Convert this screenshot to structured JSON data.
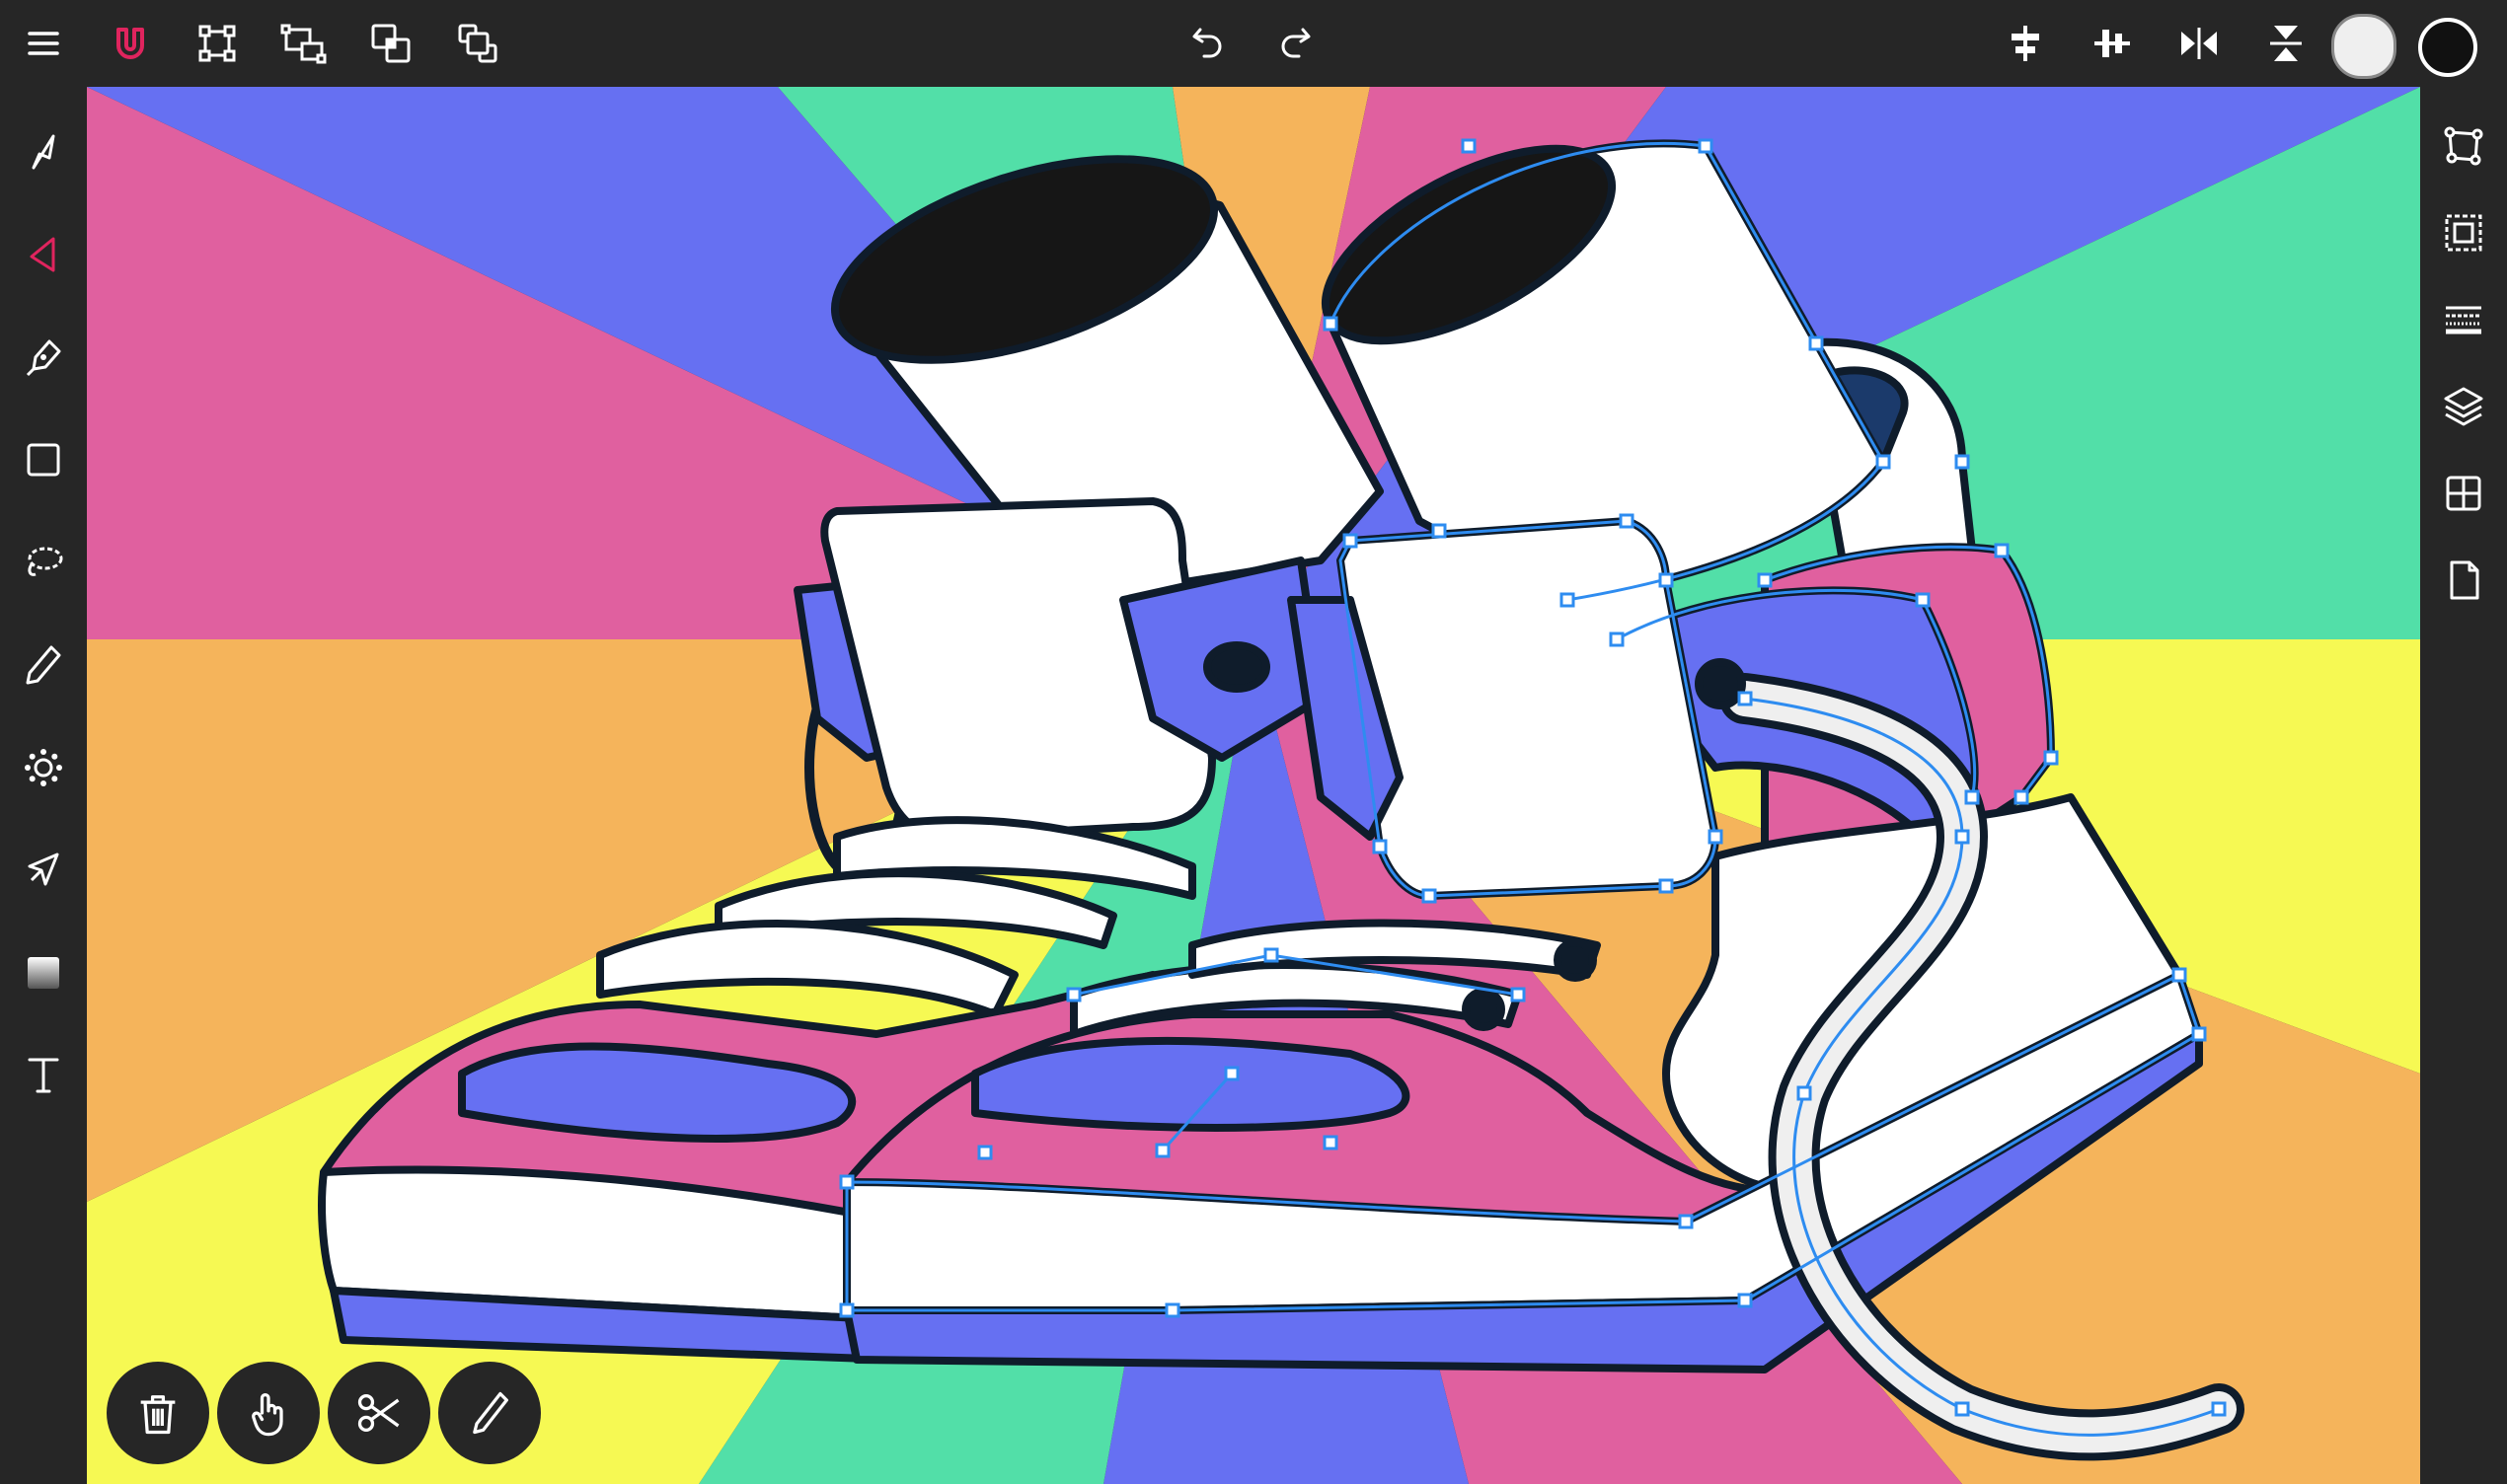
{
  "colors": {
    "chrome": "#262626",
    "icon": "#ffffff",
    "accent": "#e0245e",
    "fill_color": "#efefef",
    "stroke_color": "#111111",
    "rays": [
      "#e0609f",
      "#6670f2",
      "#52dfa8",
      "#f5b45b",
      "#f6f953"
    ],
    "shoe_pink": "#e0609f",
    "shoe_blue": "#6670f2",
    "shoe_white": "#ffffff",
    "outline": "#0f1c2b",
    "selection": "#2e8cf0"
  },
  "top_toolbar": {
    "left_tools": [
      "menu-icon",
      "snapping-magnet-icon",
      "transform-icon",
      "distribute-icon",
      "boolean-icon",
      "arrange-icon"
    ],
    "history": [
      "undo-icon",
      "redo-icon"
    ],
    "right_tools": [
      "align-horizontal-icon",
      "align-vertical-icon",
      "flip-horizontal-icon",
      "flip-vertical-icon"
    ],
    "fill_swatch": "fill-color",
    "stroke_swatch": "stroke-color"
  },
  "left_toolbar": {
    "active_tool": "node-tool",
    "tools": [
      "move-tool",
      "node-tool",
      "pen-tool",
      "shape-tool",
      "lasso-tool",
      "pencil-tool",
      "brush-tool",
      "knife-tool",
      "gradient-tool",
      "text-tool"
    ]
  },
  "right_toolbar": {
    "panels": [
      "transform-panel",
      "selection-panel",
      "style-panel",
      "layers-panel",
      "grid-panel",
      "document-panel"
    ]
  },
  "node_actions": [
    "delete-node-icon",
    "touch-modifier-icon",
    "cut-path-icon",
    "smooth-node-icon"
  ]
}
